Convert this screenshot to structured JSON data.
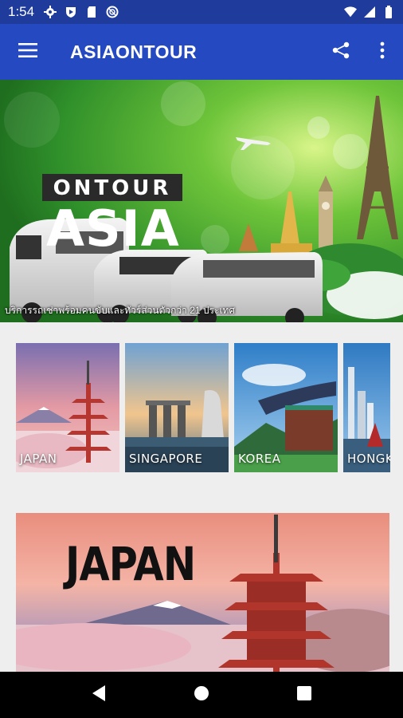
{
  "status_bar": {
    "time": "1:54",
    "left_icons": [
      "gear-icon",
      "shield-icon",
      "sd-card-icon",
      "no-disturb-icon"
    ],
    "right_icons": [
      "wifi-icon",
      "signal-icon",
      "battery-icon"
    ]
  },
  "app_bar": {
    "title": "ASIAONTOUR",
    "menu_icon": "hamburger-menu-icon",
    "actions": [
      "share-icon",
      "more-vert-icon"
    ],
    "color": "#2449c0"
  },
  "hero_banner": {
    "logo_top": "ASIA",
    "logo_bottom": "ONTOUR",
    "caption": "บริการรถเช่าพร้อมคนขับและทัวร์ส่วนตัวกว่า 21 ประเทศ"
  },
  "destinations": [
    {
      "label": "JAPAN"
    },
    {
      "label": "SINGAPORE"
    },
    {
      "label": "KOREA"
    },
    {
      "label": "HONGKONG"
    }
  ],
  "featured": {
    "title": "JAPAN"
  },
  "nav_bar": {
    "buttons": [
      "back-icon",
      "home-icon",
      "recents-icon"
    ]
  }
}
